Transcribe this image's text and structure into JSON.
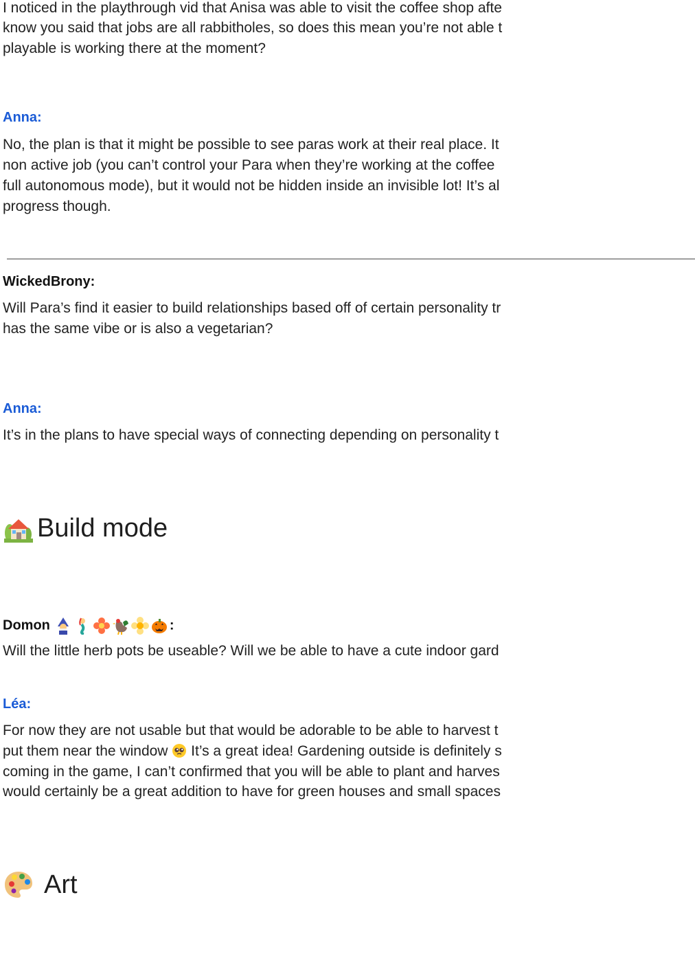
{
  "blocks": [
    {
      "lines": [
        "I noticed in the playthrough vid that Anisa was able to visit the coffee shop afte",
        "know you said that jobs are all rabbitholes, so does this mean you’re not able t",
        "playable is working there at the moment?"
      ]
    },
    {
      "speaker": "Anna:",
      "lines": [
        "No, the plan is that it might be possible to see paras work at their real place. It",
        "non active job (you can’t control your Para when they’re working at the coffee",
        "full autonomous mode), but it would not be hidden inside an invisible lot! It’s al",
        "progress though."
      ]
    },
    {
      "speaker": "WickedBrony:",
      "lines": [
        "Will Para’s find it easier to build relationships based off of certain personality tr",
        "has the same vibe or is also a vegetarian?"
      ]
    },
    {
      "speaker": "Anna:",
      "lines": [
        "It’s in the plans to have special ways of connecting depending on personality t"
      ]
    }
  ],
  "section_build": {
    "icon": "house-icon",
    "title": "Build mode"
  },
  "build_blocks": [
    {
      "speaker": "Domon",
      "speaker_suffix": ":",
      "emoji": [
        "mage-emoji",
        "mermaid-emoji",
        "flower-emoji",
        "rooster-emoji",
        "blossom-emoji",
        "jack-o-lantern-emoji"
      ],
      "lines": [
        "Will the little herb pots be useable? Will we be able to have a cute indoor gard"
      ]
    },
    {
      "speaker": "Léa:",
      "line_1": "For now they are not usable but that would be adorable to be able to harvest t",
      "line_2_before": "put them near the window ",
      "line_2_emoji": "pleading-face-emoji",
      "line_2_after": " It’s a great idea! Gardening outside is definitely s",
      "line_3": "coming in the game, I can’t confirmed that you will be able to plant and harves",
      "line_4": "would certainly be a great addition to have for green houses and small spaces"
    }
  ],
  "section_art": {
    "icon": "palette-icon",
    "title": "Art"
  }
}
